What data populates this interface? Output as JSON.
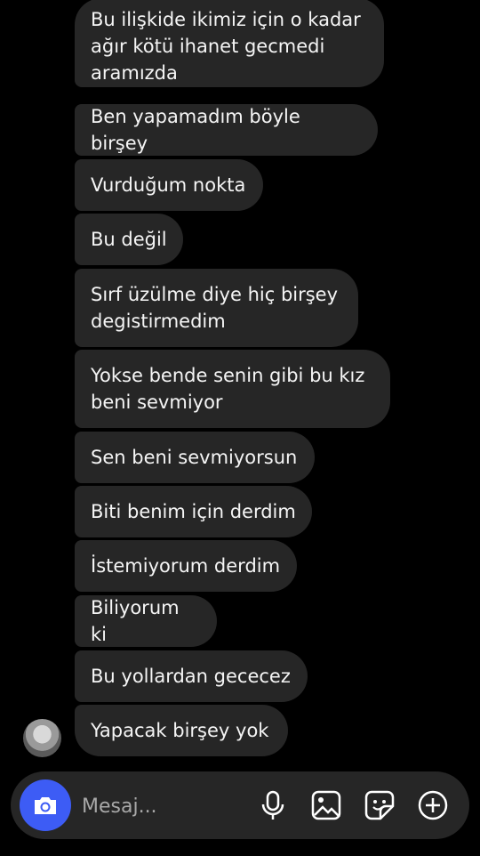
{
  "messages": [
    {
      "text": "Bu ilişkide ikimiz için o kadar\nağır kötü ihanet gecmedi\naramızda"
    },
    {
      "text": "Ben yapamadım böyle birşey"
    },
    {
      "text": "Vurduğum nokta"
    },
    {
      "text": "Bu değil"
    },
    {
      "text": "Sırf üzülme diye hiç birşey\ndegistirmedim"
    },
    {
      "text": "Yokse bende senin gibi bu kız\nbeni sevmiyor"
    },
    {
      "text": "Sen beni sevmiyorsun"
    },
    {
      "text": "Biti benim için derdim"
    },
    {
      "text": "İstemiyorum derdim"
    },
    {
      "text": "Biliyorum ki"
    },
    {
      "text": "Bu yollardan gececez"
    },
    {
      "text": "Yapacak birşey yok"
    }
  ],
  "composer": {
    "placeholder": "Mesaj...",
    "camera_icon": "camera-icon",
    "mic_icon": "microphone-icon",
    "gallery_icon": "gallery-icon",
    "sticker_icon": "sticker-icon",
    "add_icon": "plus-circle-icon",
    "accent_color": "#3d5cf5"
  },
  "colors": {
    "background": "#000000",
    "bubble": "#262626",
    "text": "#f5f5f5"
  }
}
